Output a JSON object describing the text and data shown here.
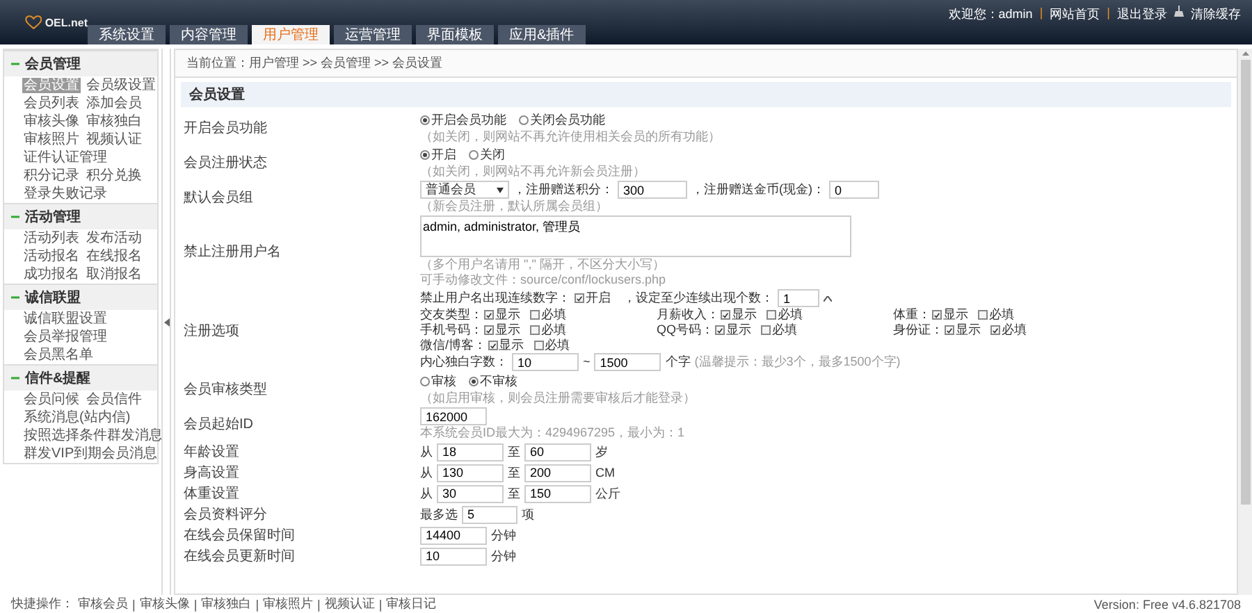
{
  "logo": "OEL.net",
  "tabs": [
    {
      "label": "系统设置",
      "selected": false
    },
    {
      "label": "内容管理",
      "selected": false
    },
    {
      "label": "用户管理",
      "selected": true
    },
    {
      "label": "运营管理",
      "selected": false
    },
    {
      "label": "界面模板",
      "selected": false
    },
    {
      "label": "应用&插件",
      "selected": false
    }
  ],
  "user_bar": {
    "welcome": "欢迎您：admin",
    "separator": "|",
    "links": [
      "网站首页",
      "退出登录"
    ],
    "clear": "清除缓存"
  },
  "sidebar": [
    {
      "title": "会员管理",
      "expanded": true,
      "rows": [
        [
          {
            "label": "会员设置",
            "selected": true
          },
          {
            "label": "会员级设置",
            "selected": false
          }
        ],
        [
          {
            "label": "会员列表",
            "selected": false
          },
          {
            "label": "添加会员",
            "selected": false
          }
        ],
        [
          {
            "label": "审核头像",
            "selected": false
          },
          {
            "label": "审核独白",
            "selected": false
          }
        ],
        [
          {
            "label": "审核照片",
            "selected": false
          },
          {
            "label": "视频认证",
            "selected": false
          }
        ],
        [
          {
            "label": "证件认证管理",
            "selected": false
          }
        ],
        [
          {
            "label": "积分记录",
            "selected": false
          },
          {
            "label": "积分兑换",
            "selected": false
          }
        ],
        [
          {
            "label": "登录失败记录",
            "selected": false
          }
        ]
      ]
    },
    {
      "title": "活动管理",
      "expanded": true,
      "rows": [
        [
          {
            "label": "活动列表",
            "selected": false
          },
          {
            "label": "发布活动",
            "selected": false
          }
        ],
        [
          {
            "label": "活动报名",
            "selected": false
          },
          {
            "label": "在线报名",
            "selected": false
          }
        ],
        [
          {
            "label": "成功报名",
            "selected": false
          },
          {
            "label": "取消报名",
            "selected": false
          }
        ]
      ]
    },
    {
      "title": "诚信联盟",
      "expanded": true,
      "rows": [
        [
          {
            "label": "诚信联盟设置",
            "selected": false
          }
        ],
        [
          {
            "label": "会员举报管理",
            "selected": false
          }
        ],
        [
          {
            "label": "会员黑名单",
            "selected": false
          }
        ]
      ]
    },
    {
      "title": "信件&提醒",
      "expanded": true,
      "rows": [
        [
          {
            "label": "会员问候",
            "selected": false
          },
          {
            "label": "会员信件",
            "selected": false
          }
        ],
        [
          {
            "label": "系统消息(站内信)",
            "selected": false
          }
        ],
        [
          {
            "label": "按照选择条件群发消息",
            "selected": false
          }
        ],
        [
          {
            "label": "群发VIP到期会员消息",
            "selected": false
          }
        ]
      ]
    }
  ],
  "breadcrumb": "当前位置：用户管理 >> 会员管理 >> 会员设置",
  "panel_title": "会员设置",
  "rows": [
    {
      "kind": "radio",
      "label": "开启会员功能",
      "options": [
        {
          "label": "开启会员功能",
          "selected": true
        },
        {
          "label": "关闭会员功能",
          "selected": false
        }
      ],
      "hint": "（如关闭，则网站不再允许使用相关会员的所有功能）"
    },
    {
      "kind": "radio",
      "label": "会员注册状态",
      "options": [
        {
          "label": "开启",
          "selected": true
        },
        {
          "label": "关闭",
          "selected": false
        }
      ],
      "hint": "（如关闭，则网站不再允许新会员注册）"
    },
    {
      "kind": "group",
      "label": "默认会员组",
      "select": "普通会员",
      "fields": [
        {
          "label": "，注册赠送积分：",
          "value": "300"
        },
        {
          "label": "，注册赠送金币(现金)：",
          "value": "0"
        }
      ],
      "hint": "（新会员注册，默认所属会员组）"
    },
    {
      "kind": "textarea",
      "label": "禁止注册用户名",
      "value": "admin, administrator, 管理员",
      "hints": [
        "（多个用户名请用 \",\" 隔开，不区分大小写）",
        "可手动修改文件：source/conf/lockusers.php"
      ]
    },
    {
      "kind": "options",
      "label": "注册选项",
      "digit_rule": {
        "text": "禁止用户名出现连续数字：",
        "check": {
          "label": "开启",
          "checked": true
        },
        "count_label": "，设定至少连续出现个数：",
        "value": "1"
      },
      "grid": [
        [
          {
            "name": "交友类型：",
            "show": {
              "label": "显示",
              "checked": true
            },
            "required": {
              "label": "必填",
              "checked": false
            }
          },
          {
            "name": "月薪收入：",
            "show": {
              "label": "显示",
              "checked": true
            },
            "required": {
              "label": "必填",
              "checked": false
            }
          },
          {
            "name": "体重：",
            "show": {
              "label": "显示",
              "checked": true
            },
            "required": {
              "label": "必填",
              "checked": false
            }
          }
        ],
        [
          {
            "name": "手机号码：",
            "show": {
              "label": "显示",
              "checked": true
            },
            "required": {
              "label": "必填",
              "checked": false
            }
          },
          {
            "name": "QQ号码：",
            "show": {
              "label": "显示",
              "checked": true
            },
            "required": {
              "label": "必填",
              "checked": false
            }
          },
          {
            "name": "身份证：",
            "show": {
              "label": "显示",
              "checked": true
            },
            "required": {
              "label": "必填",
              "checked": true
            }
          }
        ],
        [
          {
            "name": "微信/博客：",
            "show": {
              "label": "显示",
              "checked": true
            },
            "required": {
              "label": "必填",
              "checked": false
            }
          }
        ]
      ],
      "length": {
        "label": "内心独白字数：",
        "min": "10",
        "sep": "~",
        "max": "1500",
        "unit": "个字",
        "hint": "(温馨提示：最少3个，最多1500个字)"
      }
    },
    {
      "kind": "radio",
      "label": "会员审核类型",
      "options": [
        {
          "label": "审核",
          "selected": false
        },
        {
          "label": "不审核",
          "selected": true
        }
      ],
      "hint": "（如启用审核，则会员注册需要审核后才能登录）"
    },
    {
      "kind": "input",
      "label": "会员起始ID",
      "value": "162000",
      "hint": "本系统会员ID最大为：4294967295，最小为：1"
    },
    {
      "kind": "range",
      "label": "年龄设置",
      "from": "从",
      "min": "18",
      "to": "至",
      "max": "60",
      "unit": "岁"
    },
    {
      "kind": "range",
      "label": "身高设置",
      "from": "从",
      "min": "130",
      "to": "至",
      "max": "200",
      "unit": "CM"
    },
    {
      "kind": "range",
      "label": "体重设置",
      "from": "从",
      "min": "30",
      "to": "至",
      "max": "150",
      "unit": "公斤"
    },
    {
      "kind": "input",
      "label": "会员资料评分",
      "prefix": "最多选",
      "value": "5",
      "unit": "项"
    },
    {
      "kind": "input",
      "label": "在线会员保留时间",
      "value": "14400",
      "unit": "分钟"
    },
    {
      "kind": "input",
      "label": "在线会员更新时间",
      "value": "10",
      "unit": "分钟"
    }
  ],
  "footer": {
    "title": "快捷操作：",
    "separator": "|",
    "links": [
      "审核会员",
      "审核头像",
      "审核独白",
      "审核照片",
      "视频认证",
      "审核日记"
    ],
    "version": "Version: Free v4.6.821708"
  }
}
